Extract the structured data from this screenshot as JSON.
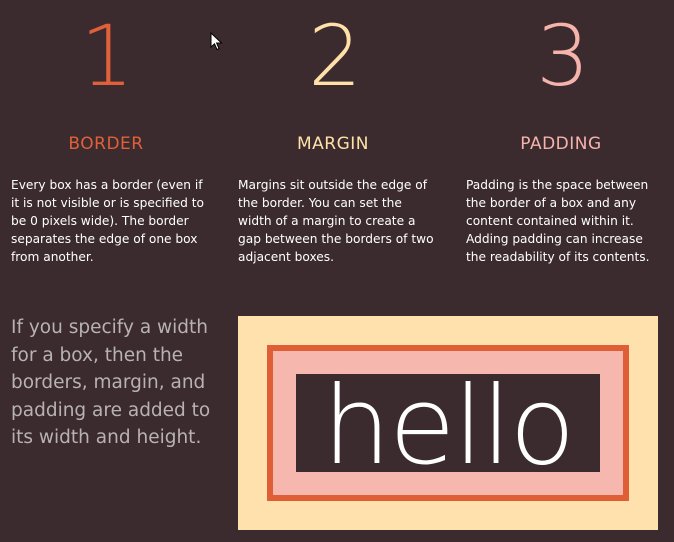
{
  "columns": [
    {
      "number": "1",
      "heading": "BORDER",
      "description": "Every box has a border (even if it is not visible or is specified to be 0 pixels wide). The border separates the edge of one box from another."
    },
    {
      "number": "2",
      "heading": "MARGIN",
      "description": "Margins sit outside the edge of the border. You can set the width of a margin to create a gap between the borders of two adjacent boxes."
    },
    {
      "number": "3",
      "heading": "PADDING",
      "description": "Padding is the space between the border of a box and any content contained within it. Adding padding can increase the readability of its contents."
    }
  ],
  "intro_text": "If you specify a width for a box, then the borders, margin, and padding are added to its width and height.",
  "example": {
    "content_text": "hello"
  },
  "colors": {
    "background": "#3b2b2e",
    "border_accent": "#e0603a",
    "margin_accent": "#ffe0a8",
    "padding_accent": "#f6b3ab",
    "body_text": "#ffffff",
    "intro_text": "#b8b2b3"
  },
  "icons": {
    "cursor": "mouse-pointer-icon"
  }
}
